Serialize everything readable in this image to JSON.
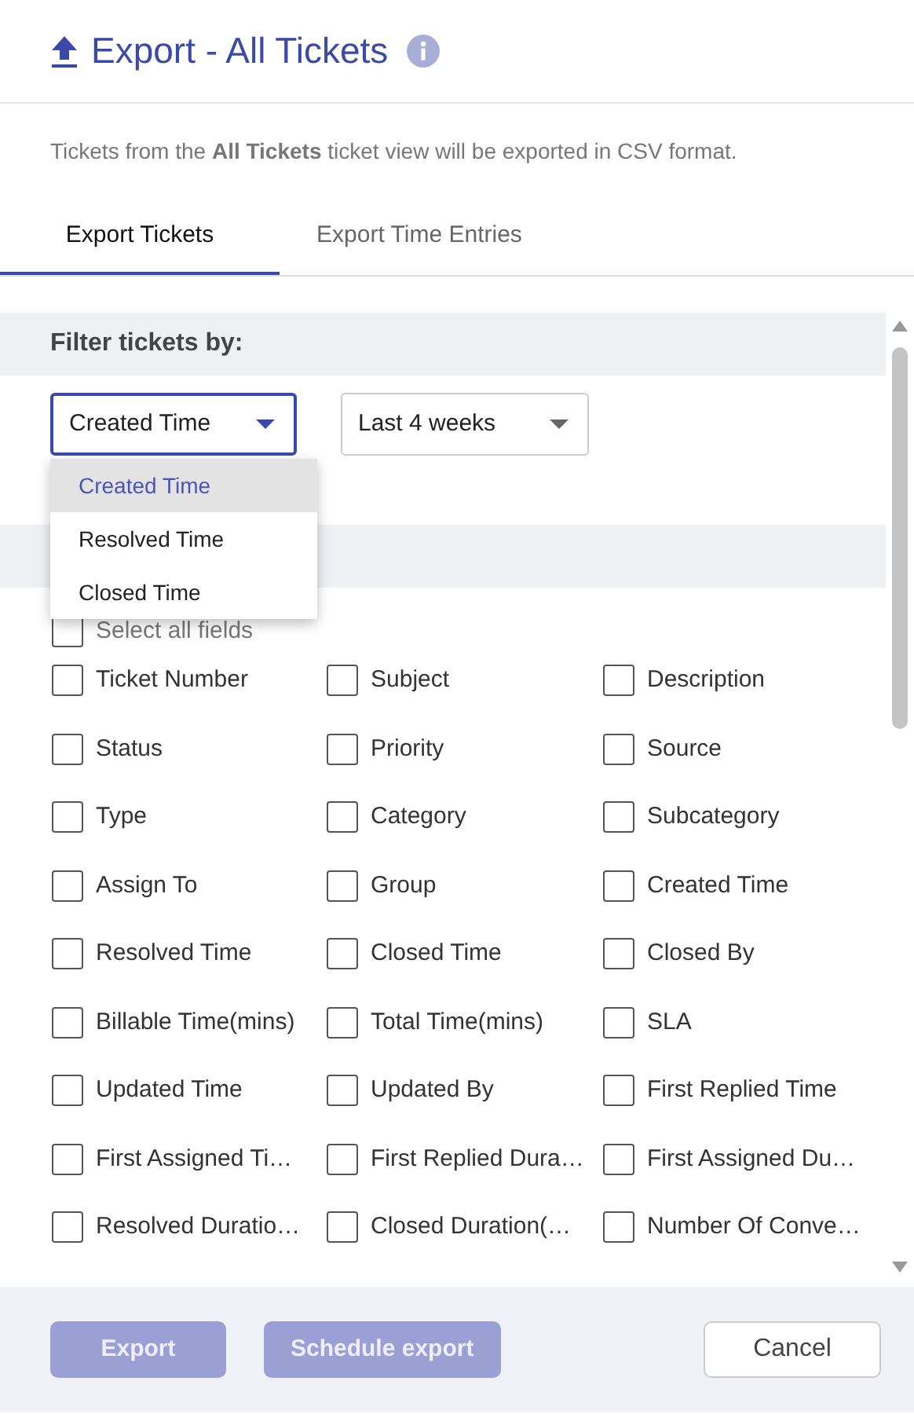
{
  "header": {
    "title": "Export - All Tickets"
  },
  "description": "Tickets from the **All Tickets** ticket view will be exported in CSV format.",
  "tabs": [
    {
      "label": "Export Tickets",
      "selected": true
    },
    {
      "label": "Export Time Entries",
      "selected": false
    }
  ],
  "filter": {
    "heading": "Filter tickets by:",
    "time_field": {
      "value": "Created Time",
      "expanded": true
    },
    "range": {
      "value": "Last 4 weeks"
    },
    "options": [
      {
        "label": "Created Time",
        "selected": true
      },
      {
        "label": "Resolved Time",
        "selected": false
      },
      {
        "label": "Closed Time",
        "selected": false
      }
    ]
  },
  "select_all": {
    "label": "Select all fields",
    "checked": false
  },
  "fields": [
    {
      "label": "Ticket Number",
      "checked": false
    },
    {
      "label": "Subject",
      "checked": false
    },
    {
      "label": "Description",
      "checked": false
    },
    {
      "label": "Status",
      "checked": false
    },
    {
      "label": "Priority",
      "checked": false
    },
    {
      "label": "Source",
      "checked": false
    },
    {
      "label": "Type",
      "checked": false
    },
    {
      "label": "Category",
      "checked": false
    },
    {
      "label": "Subcategory",
      "checked": false
    },
    {
      "label": "Assign To",
      "checked": false
    },
    {
      "label": "Group",
      "checked": false
    },
    {
      "label": "Created Time",
      "checked": false
    },
    {
      "label": "Resolved Time",
      "checked": false
    },
    {
      "label": "Closed Time",
      "checked": false
    },
    {
      "label": "Closed By",
      "checked": false
    },
    {
      "label": "Billable Time(mins)",
      "checked": false
    },
    {
      "label": "Total Time(mins)",
      "checked": false
    },
    {
      "label": "SLA",
      "checked": false
    },
    {
      "label": "Updated Time",
      "checked": false
    },
    {
      "label": "Updated By",
      "checked": false
    },
    {
      "label": "First Replied Time",
      "checked": false
    },
    {
      "label": "First Assigned Ti…",
      "checked": false
    },
    {
      "label": "First Replied Dura…",
      "checked": false
    },
    {
      "label": "First Assigned Du…",
      "checked": false
    },
    {
      "label": "Resolved Duratio…",
      "checked": false
    },
    {
      "label": "Closed Duration(…",
      "checked": false
    },
    {
      "label": "Number Of Conve…",
      "checked": false
    }
  ],
  "buttons": [
    {
      "label": "Export",
      "kind": "primary",
      "disabled": true
    },
    {
      "label": "Schedule export",
      "kind": "primary",
      "disabled": true
    },
    {
      "label": "Cancel",
      "kind": "secondary",
      "disabled": false
    }
  ]
}
